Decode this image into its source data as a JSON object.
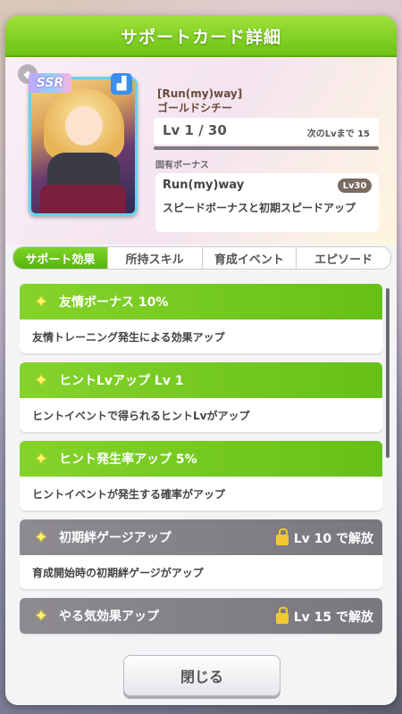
{
  "dialog": {
    "title": "サポートカード詳細"
  },
  "card": {
    "rarity": "SSR",
    "type_icon": "shoe-icon",
    "title": "[Run(my)way]",
    "name": "ゴールドシチー",
    "level": "Lv 1 / 30",
    "next_level": "次のLvまで 15",
    "level_progress": 0
  },
  "unique_bonus": {
    "label": "固有ボーナス",
    "name": "Run(my)way",
    "level": "Lv30",
    "description": "スピードボーナスと初期スピードアップ"
  },
  "tabs": [
    {
      "label": "サポート効果",
      "active": true
    },
    {
      "label": "所持スキル",
      "active": false
    },
    {
      "label": "育成イベント",
      "active": false
    },
    {
      "label": "エピソード",
      "active": false
    }
  ],
  "effects": [
    {
      "title": "友情ボーナス 10%",
      "description": "友情トレーニング発生による効果アップ",
      "locked": false
    },
    {
      "title": "ヒントLvアップ Lv 1",
      "description": "ヒントイベントで得られるヒントLvがアップ",
      "locked": false
    },
    {
      "title": "ヒント発生率アップ 5%",
      "description": "ヒントイベントが発生する確率がアップ",
      "locked": false
    },
    {
      "title": "初期絆ゲージアップ",
      "description": "育成開始時の初期絆ゲージがアップ",
      "locked": true,
      "unlock": "Lv 10 で解放"
    },
    {
      "title": "やる気効果アップ",
      "description": "",
      "locked": true,
      "unlock": "Lv 15 で解放"
    }
  ],
  "close_label": "閉じる",
  "colors": {
    "accent_green": "#6cc412",
    "locked_gray": "#7a777e"
  }
}
